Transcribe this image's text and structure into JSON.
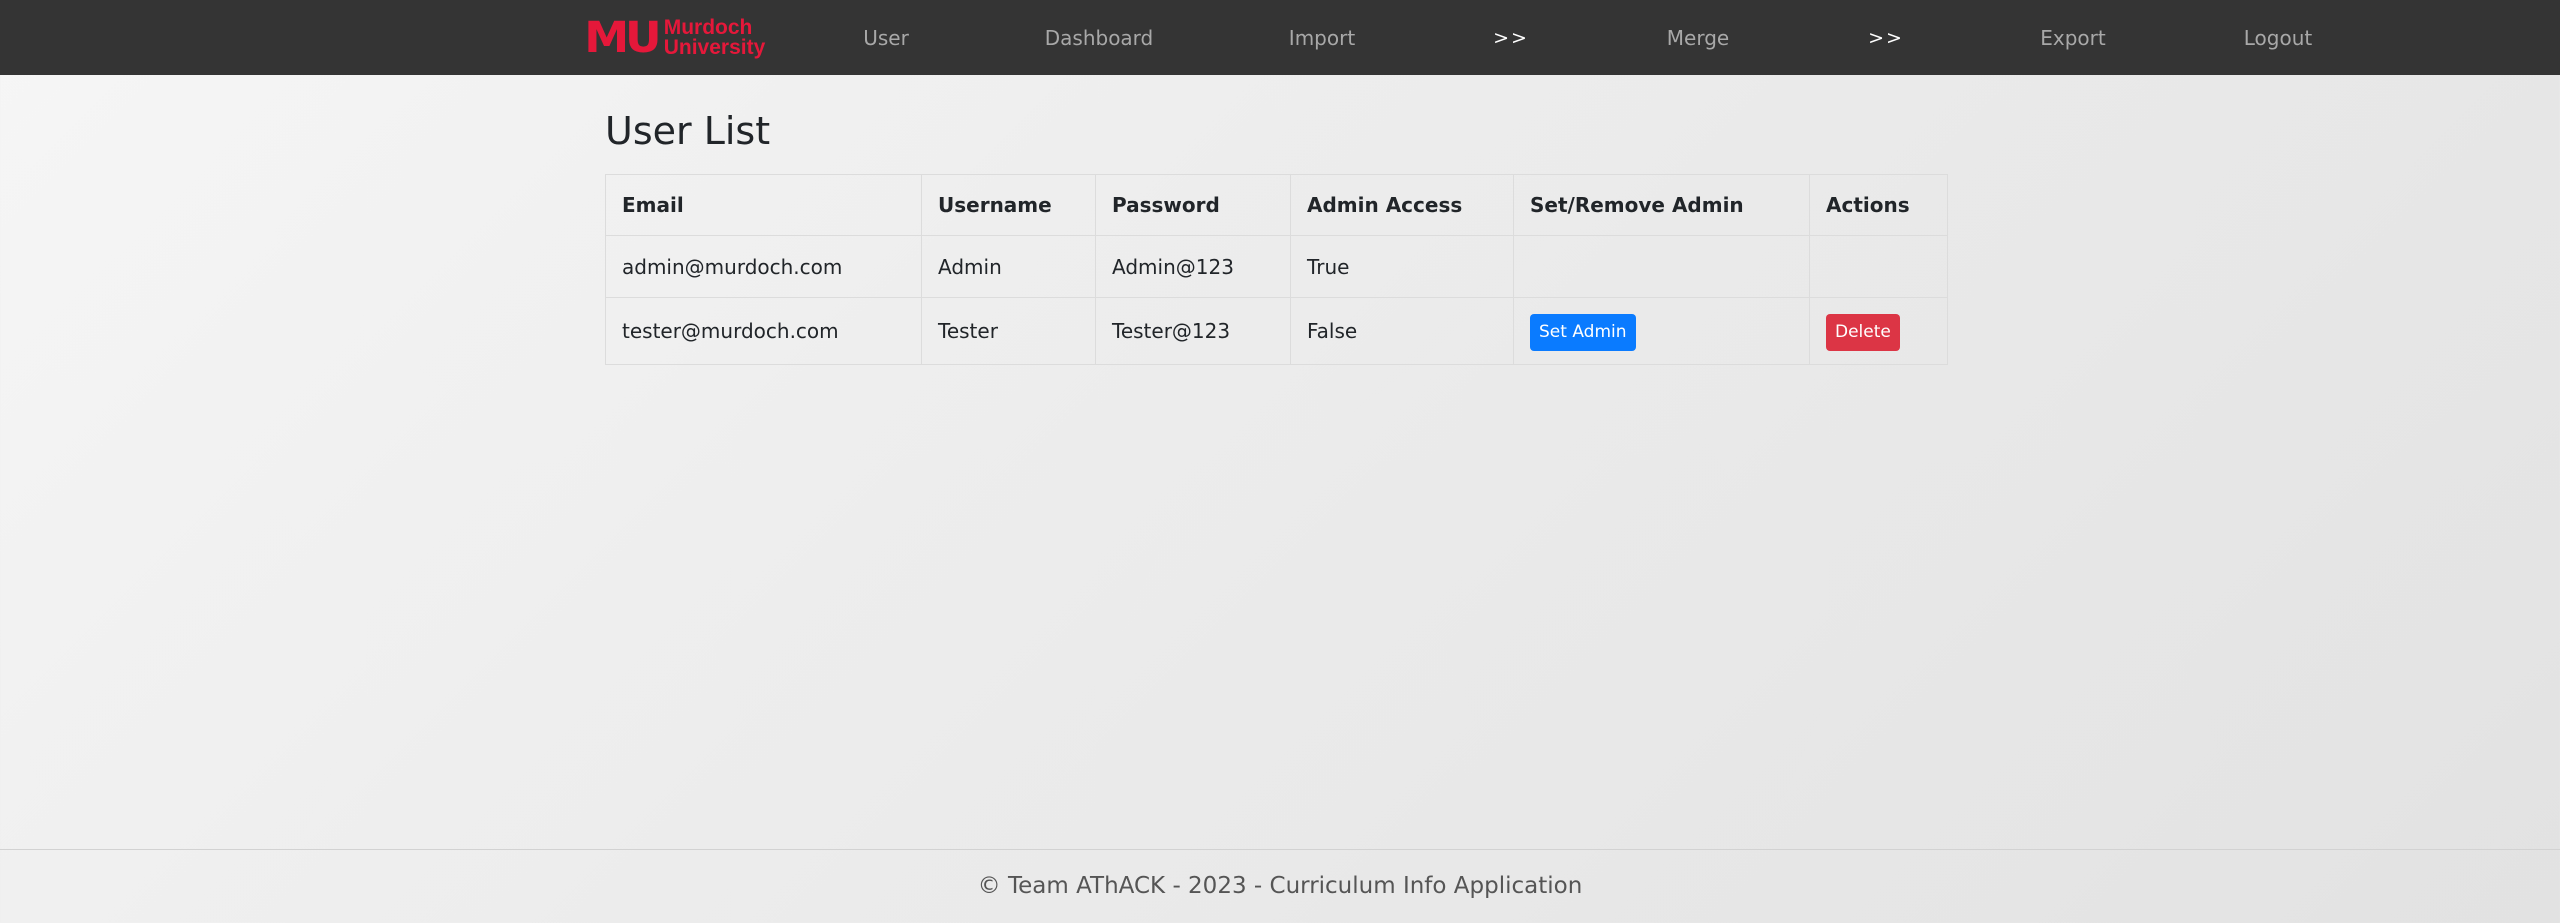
{
  "brand": {
    "mark": "MU",
    "line1": "Murdoch",
    "line2": "University",
    "color": "#e5183a"
  },
  "nav": {
    "user": "User",
    "dashboard": "Dashboard",
    "import": "Import",
    "sep1": ">>",
    "merge": "Merge",
    "sep2": ">>",
    "export": "Export",
    "logout": "Logout"
  },
  "page": {
    "title": "User List"
  },
  "table": {
    "headers": [
      "Email",
      "Username",
      "Password",
      "Admin Access",
      "Set/Remove Admin",
      "Actions"
    ],
    "rows": [
      {
        "email": "admin@murdoch.com",
        "username": "Admin",
        "password": "Admin@123",
        "admin_access": "True"
      },
      {
        "email": "tester@murdoch.com",
        "username": "Tester",
        "password": "Tester@123",
        "admin_access": "False",
        "set_admin_label": "Set Admin",
        "delete_label": "Delete"
      }
    ]
  },
  "footer": {
    "text": "© Team AThACK - 2023 - Curriculum Info Application"
  },
  "colors": {
    "navbar": "#343434",
    "primary": "#0a7bff",
    "danger": "#dc3545"
  }
}
